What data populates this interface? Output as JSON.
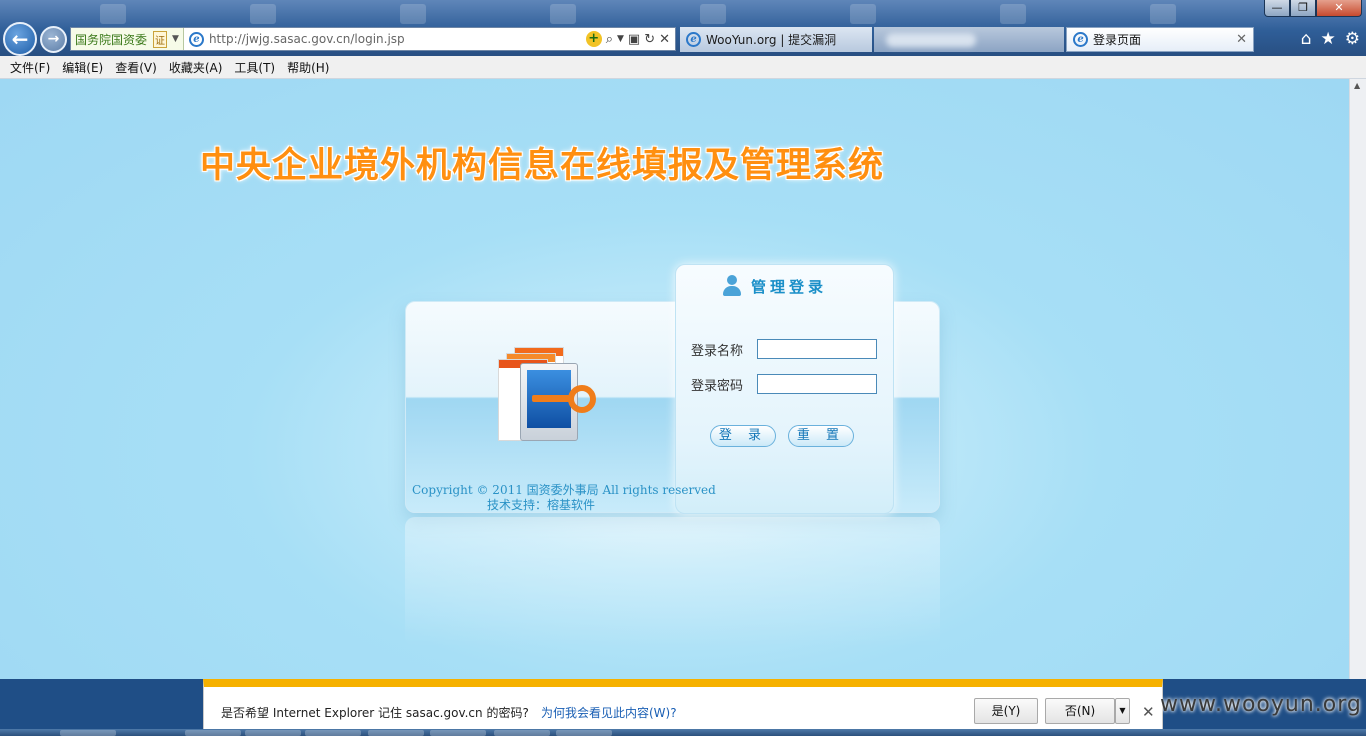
{
  "browser": {
    "cert_name": "国务院国资委",
    "cert_badge": "证",
    "url": "http://jwjg.sasac.gov.cn/login.jsp",
    "tabs": [
      {
        "label": "WooYun.org | 提交漏洞",
        "active": false
      },
      {
        "label": "",
        "active": false
      },
      {
        "label": "登录页面",
        "active": true
      }
    ],
    "window_controls": {
      "minimize": "—",
      "maximize": "❐",
      "close": "✕"
    }
  },
  "menu": [
    "文件(F)",
    "编辑(E)",
    "查看(V)",
    "收藏夹(A)",
    "工具(T)",
    "帮助(H)"
  ],
  "page": {
    "system_title": "中央企业境外机构信息在线填报及管理系统",
    "login_heading": "管理登录",
    "username_label": "登录名称",
    "password_label": "登录密码",
    "username_value": "",
    "password_value": "",
    "login_button": "登 录",
    "reset_button": "重 置",
    "copyright": "Copyright © 2011 国资委外事局  All rights reserved",
    "support": "技术支持：榕基软件"
  },
  "notification": {
    "message": "是否希望 Internet Explorer 记住 sasac.gov.cn 的密码?",
    "link": "为何我会看见此内容(W)?",
    "yes": "是(Y)",
    "no": "否(N)"
  },
  "watermark": "www.wooyun.org",
  "colors": {
    "title_orange": "#ff8f10",
    "page_bg": "#9ed8f3",
    "accent_blue": "#1a8fc8",
    "notification_bar": "#f6b100"
  }
}
